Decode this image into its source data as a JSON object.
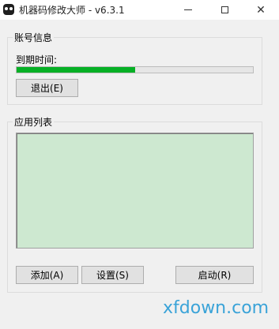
{
  "window": {
    "title": "机器码修改大师 - v6.3.1",
    "close_glyph": "✕"
  },
  "account": {
    "group_title": "账号信息",
    "expiry_label": "到期时间:",
    "progress_fraction": 0.5,
    "logout_label": "退出(E)"
  },
  "apps": {
    "group_title": "应用列表",
    "items": [],
    "add_label": "添加(A)",
    "settings_label": "设置(S)",
    "start_label": "启动(R)"
  },
  "watermark": {
    "text": "xfdown.com"
  },
  "colors": {
    "progress_fill": "#06b025",
    "list_background": "#cde8d0",
    "watermark": "#3aa3d8"
  },
  "icons": [
    "app-icon",
    "minimize-icon",
    "maximize-icon",
    "close-icon"
  ]
}
